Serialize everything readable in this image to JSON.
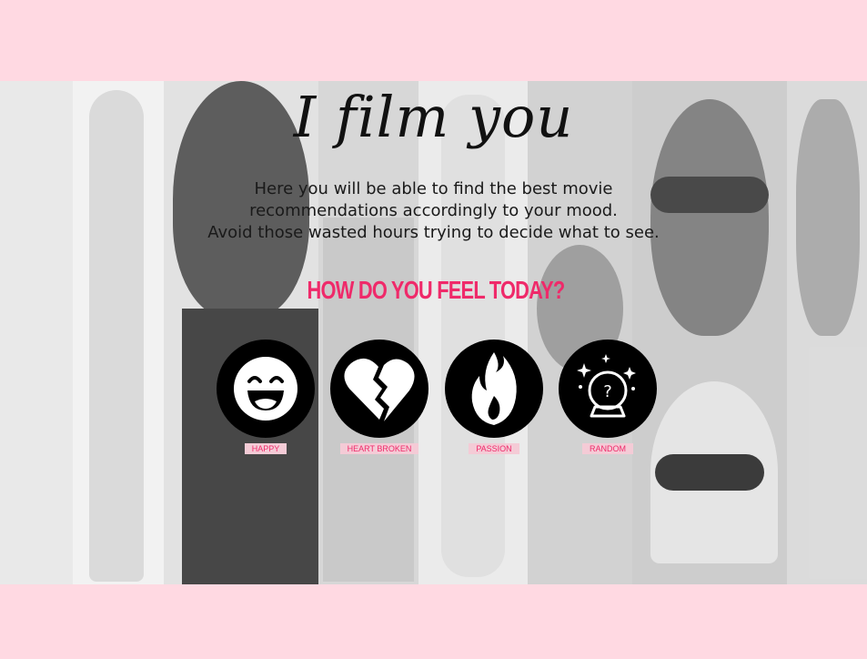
{
  "app": {
    "logo_text": "I film you"
  },
  "intro": {
    "lines": [
      "Here you will be able to find the best movie",
      "recommendations accordingly to your mood.",
      "Avoid those wasted hours trying to decide what to see."
    ]
  },
  "question": "HOW DO YOU FEEL TODAY?",
  "moods": [
    {
      "label": "HAPPY",
      "icon": "smile-icon"
    },
    {
      "label": "HEART BROKEN",
      "icon": "broken-heart-icon"
    },
    {
      "label": "PASSION",
      "icon": "flame-icon"
    },
    {
      "label": "RANDOM",
      "icon": "crystal-ball-icon"
    }
  ],
  "colors": {
    "page_background": "#ffd9e2",
    "accent": "#ef2a6a",
    "label_background": "#f4cbd6",
    "icon_circle": "#000000"
  }
}
